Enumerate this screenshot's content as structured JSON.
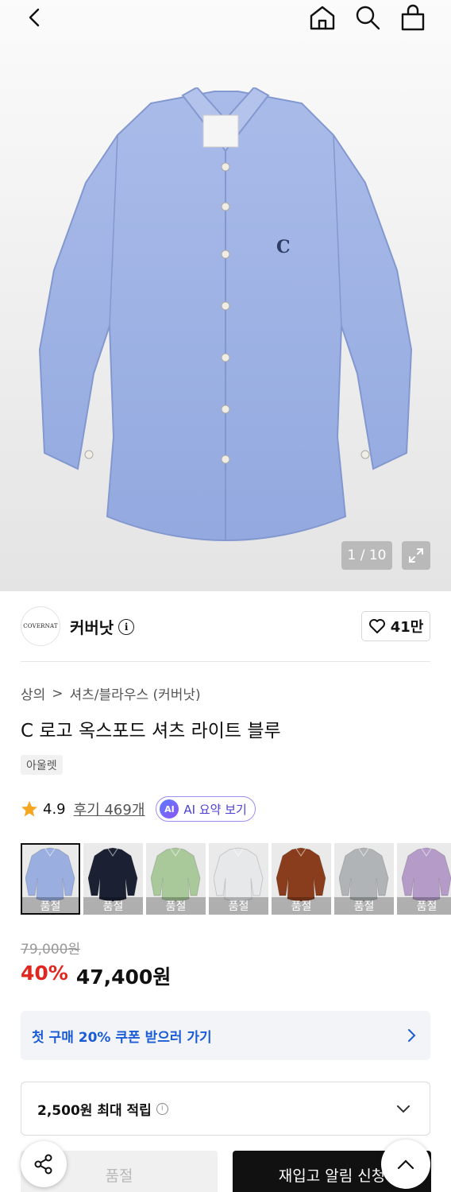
{
  "nav": {
    "back_icon": "back-arrow-icon",
    "home_icon": "home-icon",
    "search_icon": "search-icon",
    "cart_icon": "shopping-bag-icon"
  },
  "gallery": {
    "counter": "1 / 10",
    "expand_icon": "expand-icon",
    "shirt_color": "#9fb3e6"
  },
  "brand": {
    "logo_text": "COVERNAT",
    "name": "커버낫",
    "info_glyph": "i",
    "likes": "41만"
  },
  "breadcrumb": {
    "category": "상의",
    "separator": ">",
    "subcategory": "셔츠/블라우스 (커버낫)"
  },
  "product": {
    "title": "C 로고 옥스포드 셔츠 라이트 블루",
    "tag": "아울렛"
  },
  "rating": {
    "score": "4.9",
    "reviews": "후기 469개",
    "ai_badge": "AI",
    "ai_label": "AI 요약 보기"
  },
  "swatches": [
    {
      "label": "품절",
      "color": "#9aaee0",
      "selected": true
    },
    {
      "label": "품절",
      "color": "#1b2133",
      "selected": false
    },
    {
      "label": "품절",
      "color": "#a9c99a",
      "selected": false
    },
    {
      "label": "품절",
      "color": "#e6e8ea",
      "selected": false
    },
    {
      "label": "품절",
      "color": "#8a3d1c",
      "selected": false
    },
    {
      "label": "품절",
      "color": "#b1b4b6",
      "selected": false
    },
    {
      "label": "품절",
      "color": "#b59bc8",
      "selected": false
    }
  ],
  "price": {
    "original": "79,000원",
    "discount": "40%",
    "final": "47,400원"
  },
  "coupon": {
    "text": "첫 구매 20% 쿠폰 받으러 가기"
  },
  "points": {
    "text": "2,500원 최대 적립",
    "info_glyph": "i"
  },
  "bottom": {
    "soldout_label": "품절",
    "restock_label": "재입고 알림 신청"
  },
  "colors": {
    "accent_red": "#e0271f",
    "coupon_blue": "#1a5bd6",
    "ai_purple": "#4a3fd6"
  }
}
